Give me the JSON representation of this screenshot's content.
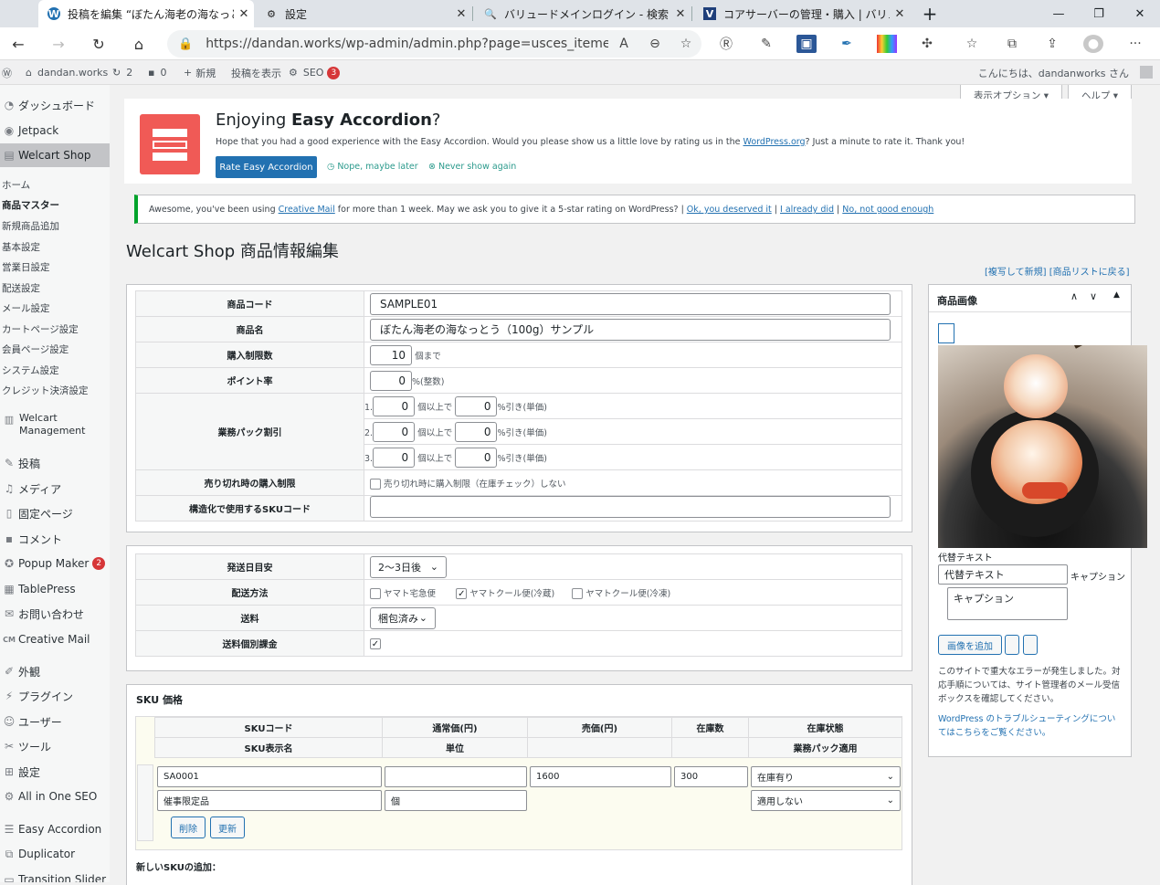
{
  "browser": {
    "tabs": [
      {
        "title": "投稿を編集 “ぼたん海老の海なっとう",
        "icon": "wordpress-icon"
      },
      {
        "title": "設定",
        "icon": "gear-icon"
      },
      {
        "title": "バリュードメインログイン - 検索",
        "icon": "search-icon"
      },
      {
        "title": "コアサーバーの管理・購入 | バリュード",
        "icon": "valuedomain-icon"
      }
    ],
    "new_tab": "+",
    "url": "https://dandan.works/wp-admin/admin.php?page=usces_itemedit..."
  },
  "adminbar": {
    "site": "dandan.works",
    "updates": "2",
    "comments": "0",
    "new": "新規",
    "view_post": "投稿を表示",
    "seo": "SEO",
    "seo_count": "3",
    "greeting": "こんにちは、dandanworks さん"
  },
  "sidebar": {
    "dashboard": "ダッシュボード",
    "jetpack": "Jetpack",
    "welcart_shop": "Welcart Shop",
    "subs": [
      "ホーム",
      "商品マスター",
      "新規商品追加",
      "基本設定",
      "営業日設定",
      "配送設定",
      "メール設定",
      "カートページ設定",
      "会員ページ設定",
      "システム設定",
      "クレジット決済設定"
    ],
    "welcart_mgmt_1": "Welcart",
    "welcart_mgmt_2": "Management",
    "posts": "投稿",
    "media": "メディア",
    "pages": "固定ページ",
    "comments": "コメント",
    "popup": "Popup Maker",
    "popup_count": "2",
    "tablepress": "TablePress",
    "contact": "お問い合わせ",
    "creative": "Creative Mail",
    "appearance": "外観",
    "plugins": "プラグイン",
    "users": "ユーザー",
    "tools": "ツール",
    "settings": "設定",
    "aioseo": "All in One SEO",
    "easyacc": "Easy Accordion",
    "duplicator": "Duplicator",
    "transition": "Transition Slider"
  },
  "top_buttons": {
    "screen_options": "表示オプション ▾",
    "help": "ヘルプ ▾"
  },
  "notice1": {
    "title_pre": "Enjoying ",
    "title_bold": "Easy Accordion",
    "title_post": "?",
    "body_1": "Hope that you had a good experience with the Easy Accordion. Would you please show us a little love by rating us in the ",
    "body_link": "WordPress.org",
    "body_2": "? Just a minute to rate it. Thank you!",
    "rate": "Rate Easy Accordion",
    "later": "Nope, maybe later",
    "never": "Never show again"
  },
  "notice2": {
    "pre": "Awesome, you've been using ",
    "link1": "Creative Mail",
    "mid": " for more than 1 week. May we ask you to give it a 5-star rating on WordPress? | ",
    "link2": "Ok, you deserved it",
    "link3": "I already did",
    "link4": "No, not good enough",
    "sep": " | "
  },
  "page": {
    "title": "Welcart Shop 商品情報編集",
    "copy_link": "[複写して新規]",
    "back_link": "[商品リストに戻る]"
  },
  "form1": {
    "code_label": "商品コード",
    "code": "SAMPLE01",
    "name_label": "商品名",
    "name": "ぼたん海老の海なっとう（100g）サンプル",
    "limit_label": "購入制限数",
    "limit": "10",
    "limit_unit": "個まで",
    "point_label": "ポイント率",
    "point": "0",
    "point_unit": "%(整数)",
    "pack_label": "業務パック割引",
    "pack_rows": [
      {
        "n": "1.",
        "qty": "0",
        "pct": "0"
      },
      {
        "n": "2.",
        "qty": "0",
        "pct": "0"
      },
      {
        "n": "3.",
        "qty": "0",
        "pct": "0"
      }
    ],
    "pack_qty_unit": "個以上で",
    "pack_pct_unit": "%引き(単価)",
    "soldout_label": "売り切れ時の購入制限",
    "soldout_text": "売り切れ時に購入制限（在庫チェック）しない",
    "sku_label": "構造化で使用するSKUコード",
    "sku_value": ""
  },
  "form2": {
    "ship_label": "発送日目安",
    "ship_value": "2〜3日後",
    "method_label": "配送方法",
    "methods": [
      {
        "label": "ヤマト宅急便",
        "checked": false
      },
      {
        "label": "ヤマトクール便(冷蔵)",
        "checked": true
      },
      {
        "label": "ヤマトクール便(冷凍)",
        "checked": false
      }
    ],
    "fee_label": "送料",
    "fee_value": "梱包済み",
    "indiv_label": "送料個別課金",
    "indiv_checked": true
  },
  "sku": {
    "title": "SKU 価格",
    "h_code": "SKUコード",
    "h_normal": "通常価(円)",
    "h_sale": "売価(円)",
    "h_stock": "在庫数",
    "h_status": "在庫状態",
    "h_disp": "SKU表示名",
    "h_unit": "単位",
    "h_pack": "業務パック適用",
    "code": "SA0001",
    "normal": "",
    "sale": "1600",
    "stock": "300",
    "status": "在庫有り",
    "disp": "催事限定品",
    "unit": "個",
    "pack": "適用しない",
    "delete": "削除",
    "update": "更新",
    "new_label": "新しいSKUの追加："
  },
  "image_box": {
    "title": "商品画像",
    "alt_label": "代替テキスト",
    "alt_value": "代替テキスト",
    "caption_label": "キャプション",
    "caption_value": "キャプション",
    "add_button": "画像を追加",
    "error": "このサイトで重大なエラーが発生しました。対応手順については、サイト管理者のメール受信ボックスを確認してください。",
    "help_link": "WordPress のトラブルシューティングについてはこちらをご覧ください。"
  },
  "colors": {
    "accent": "#2271b1",
    "notice_border": "#00a32a",
    "badge": "#d63638",
    "easyacc": "#f05a56"
  }
}
